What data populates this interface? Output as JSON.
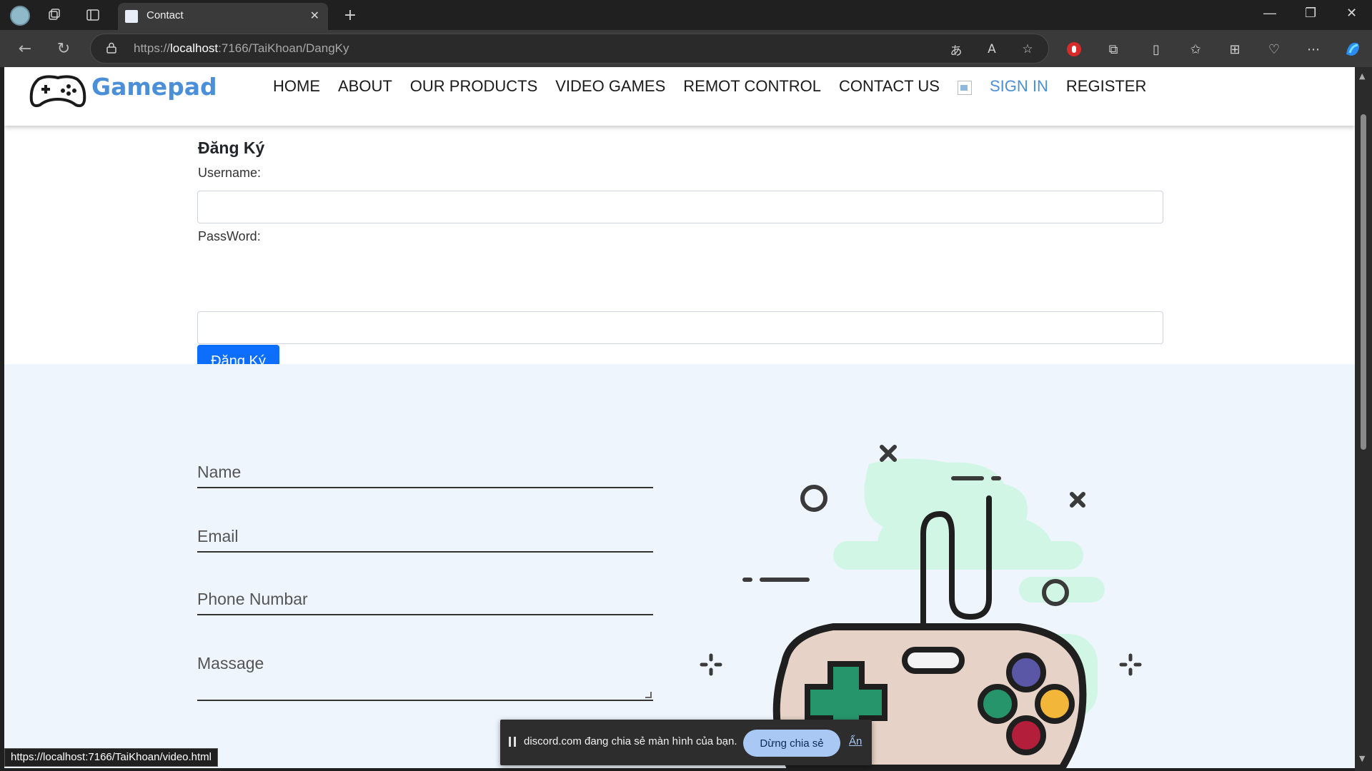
{
  "browser": {
    "tab_title": "Contact",
    "url_prefix": "https://",
    "url_host": "localhost",
    "url_rest": ":7166/TaiKhoan/DangKy"
  },
  "site": {
    "logo_text": "Gamepad",
    "nav": [
      {
        "label": "HOME"
      },
      {
        "label": "ABOUT"
      },
      {
        "label": "OUR PRODUCTS"
      },
      {
        "label": "VIDEO GAMES"
      },
      {
        "label": "REMOT CONTROL"
      },
      {
        "label": "CONTACT US"
      },
      {
        "label": "SIGN IN"
      },
      {
        "label": "REGISTER"
      }
    ]
  },
  "register_form": {
    "title": "Đăng Ký",
    "username_label": "Username:",
    "password_label": "PassWord:",
    "submit_label": "Đăng Ký"
  },
  "contact_form": {
    "name_placeholder": "Name",
    "email_placeholder": "Email",
    "phone_placeholder": "Phone Numbar",
    "message_placeholder": "Massage"
  },
  "status_bar": {
    "url": "https://localhost:7166/TaiKhoan/video.html"
  },
  "screen_share": {
    "message": "discord.com đang chia sẻ màn hình của bạn.",
    "stop_label": "Dừng chia sẻ",
    "hide_label": "Ẩn"
  },
  "colors": {
    "brand_blue": "#4a8fd8",
    "primary_button": "#0d6efd",
    "contact_bg": "#eef5fc"
  }
}
